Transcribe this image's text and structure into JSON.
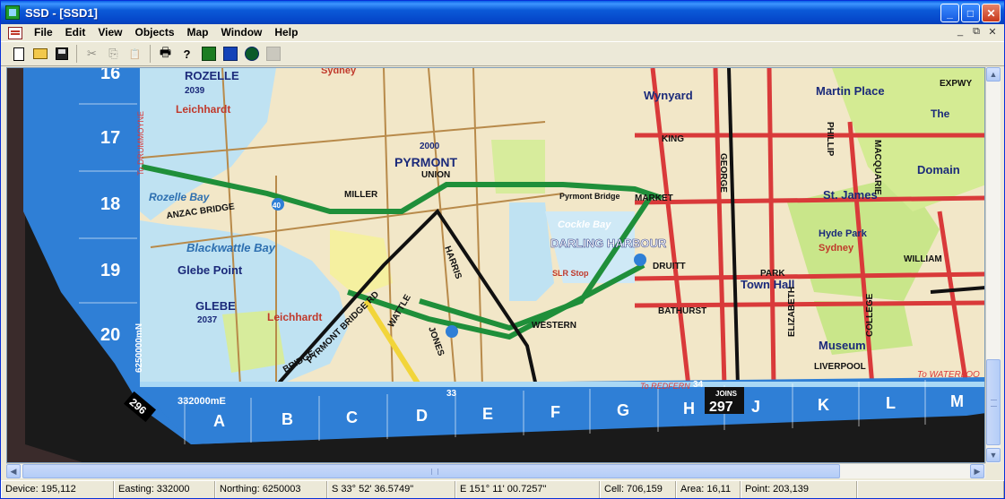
{
  "window": {
    "title": "SSD - [SSD1]",
    "minimize_glyph": "_",
    "maximize_glyph": "□",
    "close_glyph": "✕"
  },
  "menu": [
    "File",
    "Edit",
    "View",
    "Objects",
    "Map",
    "Window",
    "Help"
  ],
  "mdi_controls": [
    "_",
    "⧉",
    "✕"
  ],
  "toolbar": {
    "buttons": [
      "new-icon",
      "open-icon",
      "save-icon",
      "cut-icon",
      "copy-icon",
      "paste-icon",
      "print-icon",
      "help-icon",
      "road-icon",
      "route-icon",
      "globe-icon",
      "layer-icon"
    ],
    "print_glyph": "🖶",
    "help_glyph": "?",
    "cut_glyph": "✂",
    "copy_glyph": "⎘",
    "paste_glyph": "📋"
  },
  "map": {
    "row_labels": [
      "16",
      "17",
      "18",
      "19",
      "20"
    ],
    "column_labels": [
      "A",
      "B",
      "C",
      "D",
      "E",
      "F",
      "G",
      "H",
      "J",
      "K",
      "L",
      "M"
    ],
    "page_number": "296",
    "joins_label": "JOINS",
    "joins_page": "297",
    "easting_label": "332000mE",
    "northing_label": "6250000mN",
    "left_margin_text": "To DRUMMOYNE",
    "bottom_numbers": [
      "33",
      "34"
    ],
    "to_redfern": "To REDFERN",
    "to_waterloo": "To WATERLOO",
    "suburbs": [
      "ROZELLE",
      "2039",
      "Leichhardt",
      "PYRMONT",
      "2000",
      "Rozelle Bay",
      "Blackwattle Bay",
      "Glebe Point",
      "GLEBE",
      "2037",
      "Leichhardt",
      "DARLING HARBOUR",
      "Cockle Bay",
      "Wynyard",
      "Martin Place",
      "St. James",
      "Hyde Park",
      "Sydney",
      "Town Hall",
      "Domain",
      "Museum",
      "Sydney",
      "The"
    ],
    "streets": [
      "ANZAC BRIDGE",
      "WESTERN",
      "HARRIS",
      "MARKET",
      "KING",
      "PARK",
      "DRUITT",
      "BATHURST",
      "LIVERPOOL",
      "GEORGE",
      "ELIZABETH",
      "COLLEGE",
      "WILLIAM",
      "EXPWY",
      "MACQUARIE",
      "PHILLIP",
      "BRIDGE",
      "PYRMONT BRIDGE RD",
      "WATTLE",
      "JONES",
      "MILLER",
      "UNION",
      "Pyrmont Bridge",
      "SLR Stop",
      "40"
    ]
  },
  "status": {
    "device": "Device: 195,112",
    "easting": "Easting: 332000",
    "northing": "Northing: 6250003",
    "lat": "S 33° 52' 36.5749\"",
    "lon": "E 151° 11' 00.7257\"",
    "cell": "Cell: 706,159",
    "area": "Area: 16,11",
    "point": "Point: 203,139"
  }
}
